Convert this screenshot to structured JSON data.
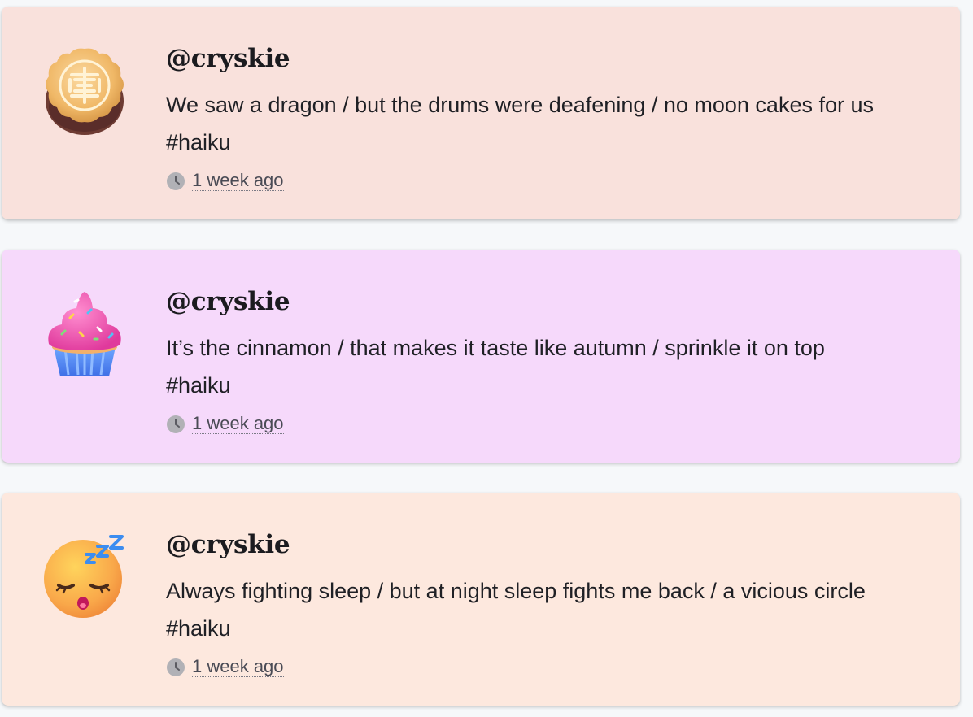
{
  "colors": {
    "page_background": "#f6f8fa",
    "card_1_background": "#f9e1dc",
    "card_2_background": "#f6d9fb",
    "card_3_background": "#fde8de"
  },
  "posts": [
    {
      "avatar_icon": "mooncake-icon",
      "username": "@cryskie",
      "text": "We saw a dragon / but the drums were deafening / no moon cakes for us",
      "hashtag": "#haiku",
      "timestamp": "1 week ago"
    },
    {
      "avatar_icon": "cupcake-icon",
      "username": "@cryskie",
      "text": "It’s the cinnamon / that makes it taste like autumn / sprinkle it on top",
      "hashtag": "#haiku",
      "timestamp": "1 week ago"
    },
    {
      "avatar_icon": "sleeping-face-icon",
      "username": "@cryskie",
      "text": "Always fighting sleep / but at night sleep fights me back / a vicious circle",
      "hashtag": "#haiku",
      "timestamp": "1 week ago"
    }
  ]
}
